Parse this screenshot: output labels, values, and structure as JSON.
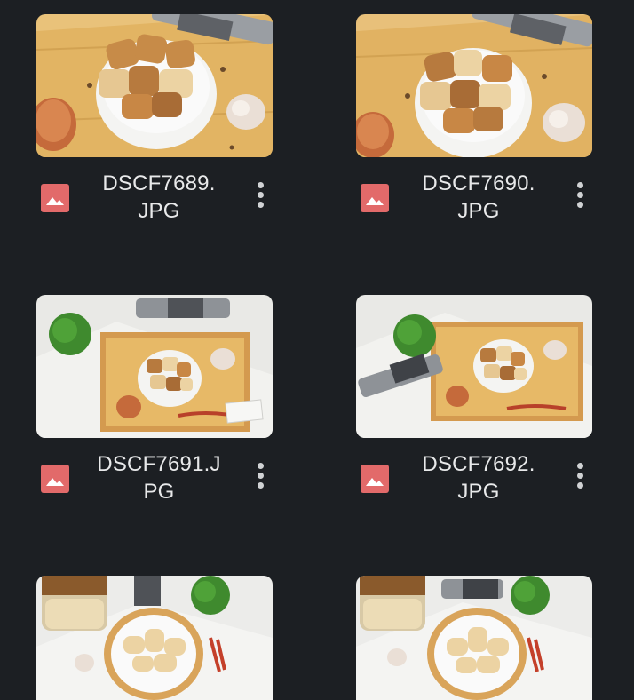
{
  "files": [
    {
      "name": "DSCF7689.\nJPG",
      "type_icon": "image-icon",
      "menu_icon": "more-vert-icon",
      "scene": "bowl-closeup"
    },
    {
      "name": "DSCF7690.\nJPG",
      "type_icon": "image-icon",
      "menu_icon": "more-vert-icon",
      "scene": "bowl-closeup"
    },
    {
      "name": "DSCF7691.J\nPG",
      "type_icon": "image-icon",
      "menu_icon": "more-vert-icon",
      "scene": "tray-topdown"
    },
    {
      "name": "DSCF7692.\nJPG",
      "type_icon": "image-icon",
      "menu_icon": "more-vert-icon",
      "scene": "tray-topdown"
    },
    {
      "name": "",
      "type_icon": "image-icon",
      "menu_icon": "more-vert-icon",
      "scene": "plate-jar"
    },
    {
      "name": "",
      "type_icon": "image-icon",
      "menu_icon": "more-vert-icon",
      "scene": "plate-jar"
    }
  ],
  "colors": {
    "background": "#1c1f23",
    "file_type_icon": "#e26a6a",
    "filename_text": "#e8e9ea",
    "menu_dots": "#d0d2d4"
  }
}
